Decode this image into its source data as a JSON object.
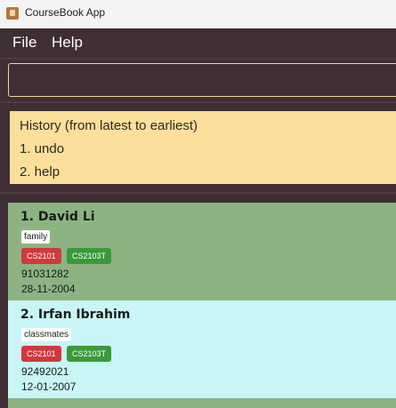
{
  "window": {
    "title": "CourseBook App",
    "icon": "app-book-icon"
  },
  "menubar": {
    "items": [
      "File",
      "Help"
    ]
  },
  "command_box": {
    "value": "",
    "placeholder": ""
  },
  "result": {
    "lines": [
      "History (from latest to earliest)",
      "1. undo",
      "2. help"
    ]
  },
  "people": [
    {
      "name": "1. David Li",
      "tag": "family",
      "courses": [
        {
          "code": "CS2101",
          "color": "#d03a3a"
        },
        {
          "code": "CS2103T",
          "color": "#3a9a3a"
        }
      ],
      "phone": "91031282",
      "date": "28-11-2004",
      "bg": "#8db383"
    },
    {
      "name": "2. Irfan Ibrahim",
      "tag": "classmates",
      "courses": [
        {
          "code": "CS2101",
          "color": "#d03a3a"
        },
        {
          "code": "CS2103T",
          "color": "#3a9a3a"
        }
      ],
      "phone": "92492021",
      "date": "12-01-2007",
      "bg": "#c8f5f5"
    }
  ],
  "colors": {
    "background": "#3f2e33",
    "result_bg": "#fcdf9a",
    "card_odd": "#8db383",
    "card_even": "#c8f5f5",
    "accent_border": "#f5d49a"
  }
}
